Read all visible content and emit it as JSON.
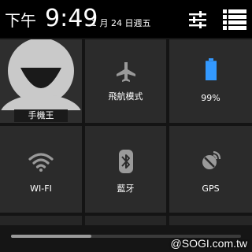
{
  "status_bar": {
    "ampm": "下午",
    "time": "9:49",
    "date": "1 月 24 日週五"
  },
  "header_icons": {
    "settings_icon": "sliders-icon",
    "list_icon": "list-icon"
  },
  "tiles": [
    {
      "label": "手機王",
      "icon": "avatar-icon"
    },
    {
      "label": "飛航模式",
      "icon": "airplane-icon"
    },
    {
      "label": "99%",
      "icon": "battery-icon",
      "battery_level": 0.99
    },
    {
      "label": "WI-FI",
      "icon": "wifi-icon"
    },
    {
      "label": "藍牙",
      "icon": "bluetooth-icon"
    },
    {
      "label": "GPS",
      "icon": "gps-icon"
    }
  ],
  "scroll": {
    "position_fraction": 0.0,
    "visible_fraction": 0.35
  },
  "watermark": "@SOGI.com.tw",
  "colors": {
    "accent_battery": "#3399ff",
    "icon_grey": "#9a9a9a",
    "tile_bg": "#2b2b2b",
    "background": "#141414"
  }
}
